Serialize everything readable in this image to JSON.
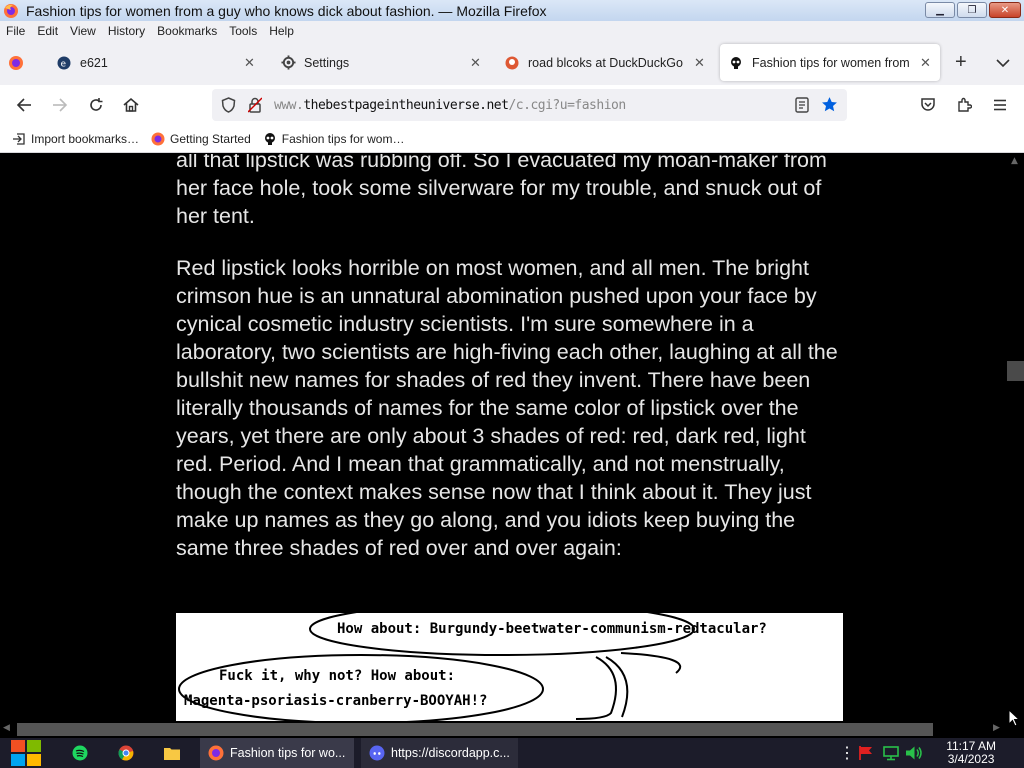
{
  "window": {
    "title": "Fashion tips for women from a guy who knows dick about fashion. — Mozilla Firefox"
  },
  "menu": [
    "File",
    "Edit",
    "View",
    "History",
    "Bookmarks",
    "Tools",
    "Help"
  ],
  "tabs": [
    {
      "label": "e621",
      "icon": "e621-icon",
      "active": false
    },
    {
      "label": "Settings",
      "icon": "gear-icon",
      "active": false
    },
    {
      "label": "road blcoks at DuckDuckGo",
      "icon": "duckduckgo-icon",
      "active": false
    },
    {
      "label": "Fashion tips for women from a",
      "icon": "skull-icon",
      "active": true
    }
  ],
  "nav": {
    "url_prefix": "www.",
    "url_domain": "thebestpageintheuniverse.net",
    "url_path": "/c.cgi?u=fashion"
  },
  "bookmarks": [
    {
      "label": "Import bookmarks…",
      "icon": "import-icon"
    },
    {
      "label": "Getting Started",
      "icon": "firefox-icon"
    },
    {
      "label": "Fashion tips for wom…",
      "icon": "skull-icon"
    }
  ],
  "article": {
    "paragraph1": "all that lipstick was rubbing off. So I evacuated my moan-maker from her face hole, took some silverware for my trouble, and snuck out of her tent.",
    "paragraph2": "Red lipstick looks horrible on most women, and all men. The bright crimson hue is an unnatural abomination pushed upon your face by cynical cosmetic industry scientists. I'm sure somewhere in a laboratory, two scientists are high-fiving each other, laughing at all the bullshit new names for shades of red they invent. There have been literally thousands of names for the same color of lipstick over the years, yet there are only about 3 shades of red: red, dark red, light red. Period. And I mean that grammatically, and not menstrually, though the context makes sense now that I think about it. They just make up names as they go along, and you idiots keep buying the same three shades of red over and over again:"
  },
  "comic": {
    "bubble1": "How about: Burgundy-beetwater-communism-redtacular?",
    "bubble2_line1": "Fuck it, why not? How about:",
    "bubble2_line2": "Magenta-psoriasis-cranberry-BOOYAH!?"
  },
  "taskbar": {
    "tasks": [
      {
        "label": "Fashion tips for wo...",
        "icon": "firefox-icon"
      },
      {
        "label": "https://discordapp.c...",
        "icon": "discord-icon"
      }
    ],
    "time": "11:17 AM",
    "date": "3/4/2023"
  },
  "colors": {
    "page_bg": "#000000",
    "text": "#e6e6e6",
    "bookmark_star": "#0060df"
  }
}
